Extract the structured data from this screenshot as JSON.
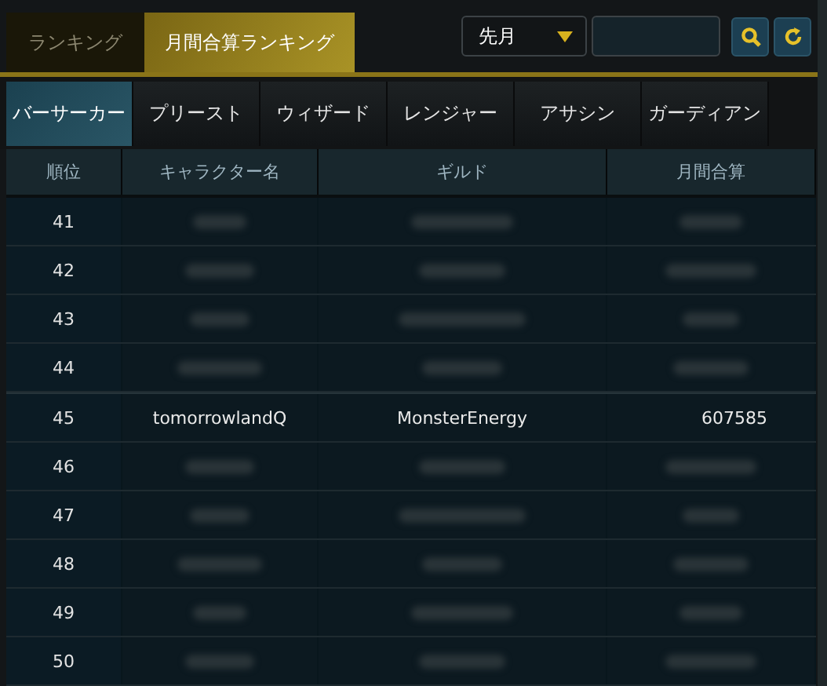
{
  "top_tabs": [
    {
      "label": "ランキング",
      "selected": false
    },
    {
      "label": "月間合算ランキング",
      "selected": true
    }
  ],
  "period_select": {
    "value": "先月"
  },
  "class_tabs": [
    {
      "label": "バーサーカー",
      "selected": true
    },
    {
      "label": "プリースト",
      "selected": false
    },
    {
      "label": "ウィザード",
      "selected": false
    },
    {
      "label": "レンジャー",
      "selected": false
    },
    {
      "label": "アサシン",
      "selected": false
    },
    {
      "label": "ガーディアン",
      "selected": false
    }
  ],
  "table": {
    "columns": [
      "順位",
      "キャラクター名",
      "ギルド",
      "月間合算"
    ],
    "rows": [
      {
        "rank": "41",
        "blurred": true
      },
      {
        "rank": "42",
        "blurred": true
      },
      {
        "rank": "43",
        "blurred": true
      },
      {
        "rank": "44",
        "blurred": true
      },
      {
        "rank": "45",
        "blurred": false,
        "character": "tomorrowlandQ",
        "guild": "MonsterEnergy",
        "total": "607585"
      },
      {
        "rank": "46",
        "blurred": true
      },
      {
        "rank": "47",
        "blurred": true
      },
      {
        "rank": "48",
        "blurred": true
      },
      {
        "rank": "49",
        "blurred": true
      },
      {
        "rank": "50",
        "blurred": true
      }
    ]
  }
}
